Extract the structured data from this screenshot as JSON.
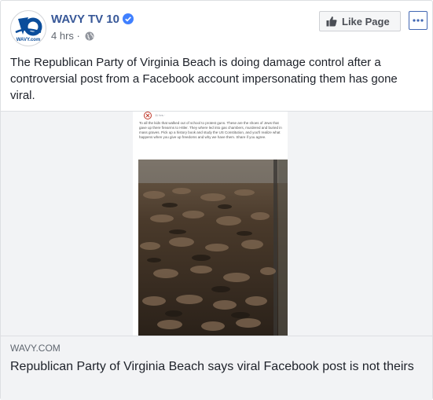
{
  "post": {
    "page_name": "WAVY TV 10",
    "time": "4 hrs",
    "separator": "·",
    "like_label": "Like Page",
    "text": "The Republican Party of Virginia Beach is doing damage control after a controversial post from a Facebook account impersonating them has gone viral.",
    "icons": {
      "verified": "verified-badge-icon",
      "globe": "globe-icon",
      "like": "thumbs-up-icon",
      "more": "more-options-icon"
    },
    "colors": {
      "brand": "#385898",
      "accent": "#4267b2"
    }
  },
  "media": {
    "time": "11 hrs ·",
    "caption": "To all the kids that walked out of school to protest guns. These are the shoes of Jews that gave up there firearms to Hitler. They where led into gas chambers, murdered and buried in mass graves. Pick up a history book and study the US Constitution, and you'll realize what happens when you give up freedoms and why we have them. Share if you agree."
  },
  "link": {
    "domain": "WAVY.COM",
    "title": "Republican Party of Virginia Beach says viral Facebook post is not theirs"
  },
  "avatar": {
    "logo_text": "WAVY.com"
  }
}
